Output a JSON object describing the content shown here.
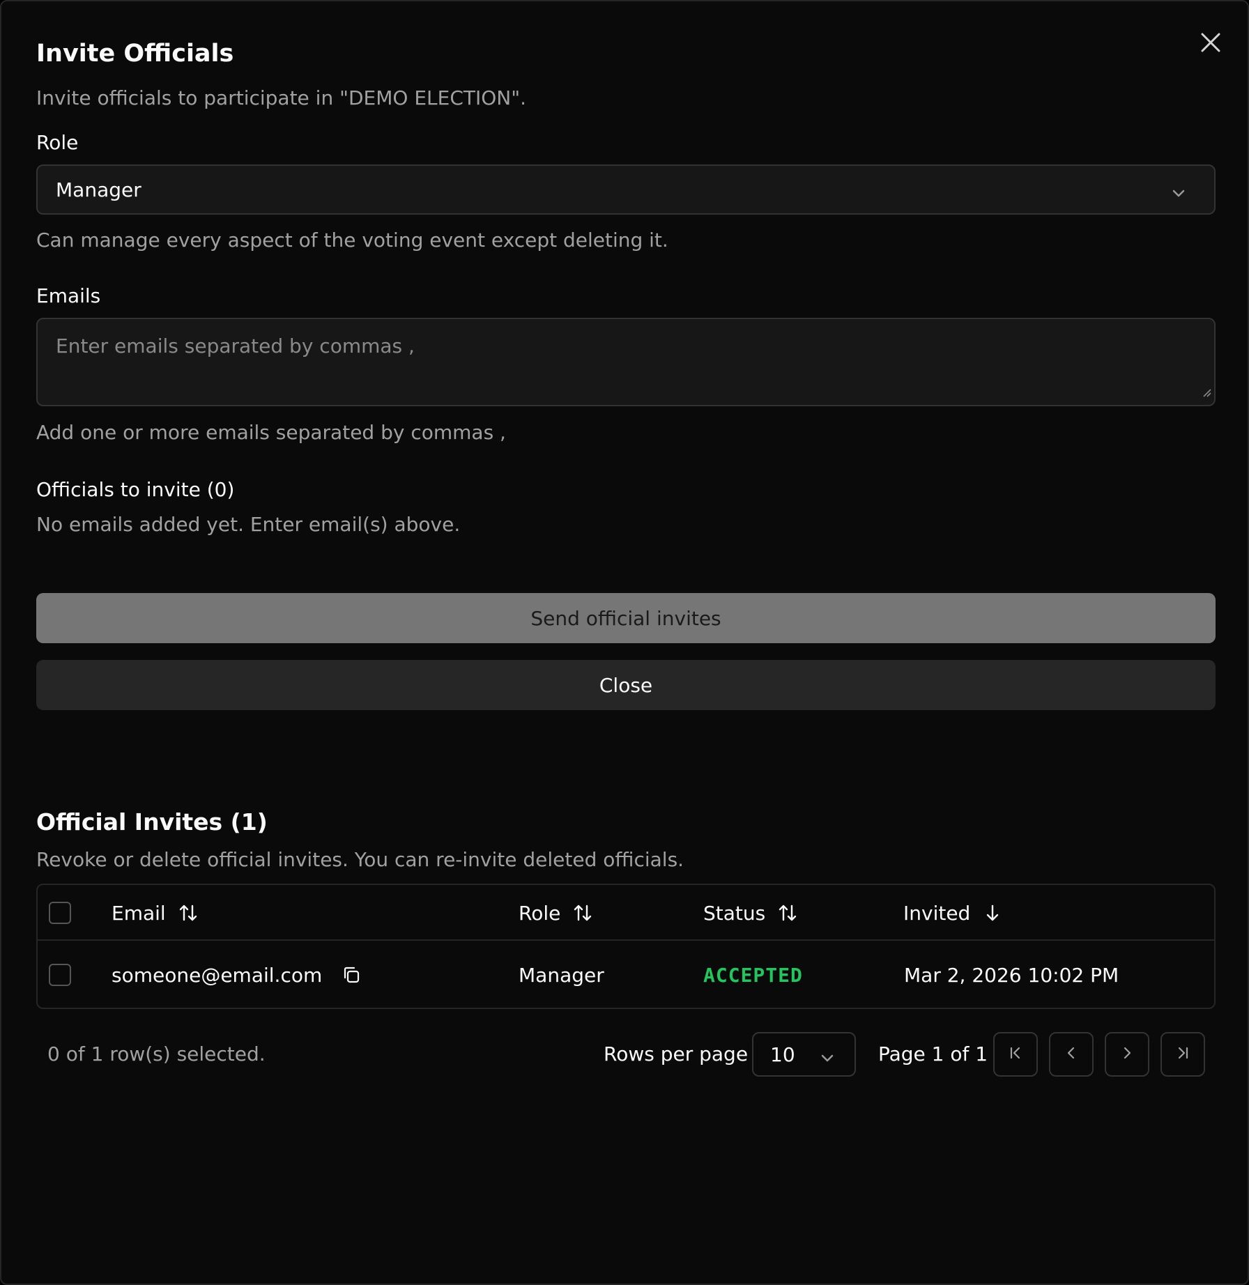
{
  "dialog": {
    "title": "Invite Officials",
    "description": "Invite officials to participate in \"DEMO ELECTION\".",
    "close_icon": "close-icon"
  },
  "role_field": {
    "label": "Role",
    "value": "Manager",
    "hint": "Can manage every aspect of the voting event except deleting it."
  },
  "emails_field": {
    "label": "Emails",
    "placeholder": "Enter emails separated by commas ,",
    "hint": "Add one or more emails separated by commas ,"
  },
  "to_invite": {
    "heading": "Officials to invite (0)",
    "empty_text": "No emails added yet. Enter email(s) above."
  },
  "buttons": {
    "send": "Send official invites",
    "close": "Close"
  },
  "invites": {
    "heading": "Official Invites (1)",
    "description": "Revoke or delete official invites. You can re-invite deleted officials.",
    "columns": [
      "Email",
      "Role",
      "Status",
      "Invited"
    ],
    "rows": [
      {
        "email": "someone@email.com",
        "role": "Manager",
        "status": "ACCEPTED",
        "invited": "Mar 2, 2026 10:02 PM"
      }
    ],
    "status_color": "#22c55e"
  },
  "pagination": {
    "selected_text": "0 of 1 row(s) selected.",
    "rows_per_page_label": "Rows per page",
    "rows_per_page_value": "10",
    "page_text": "Page 1 of 1"
  }
}
